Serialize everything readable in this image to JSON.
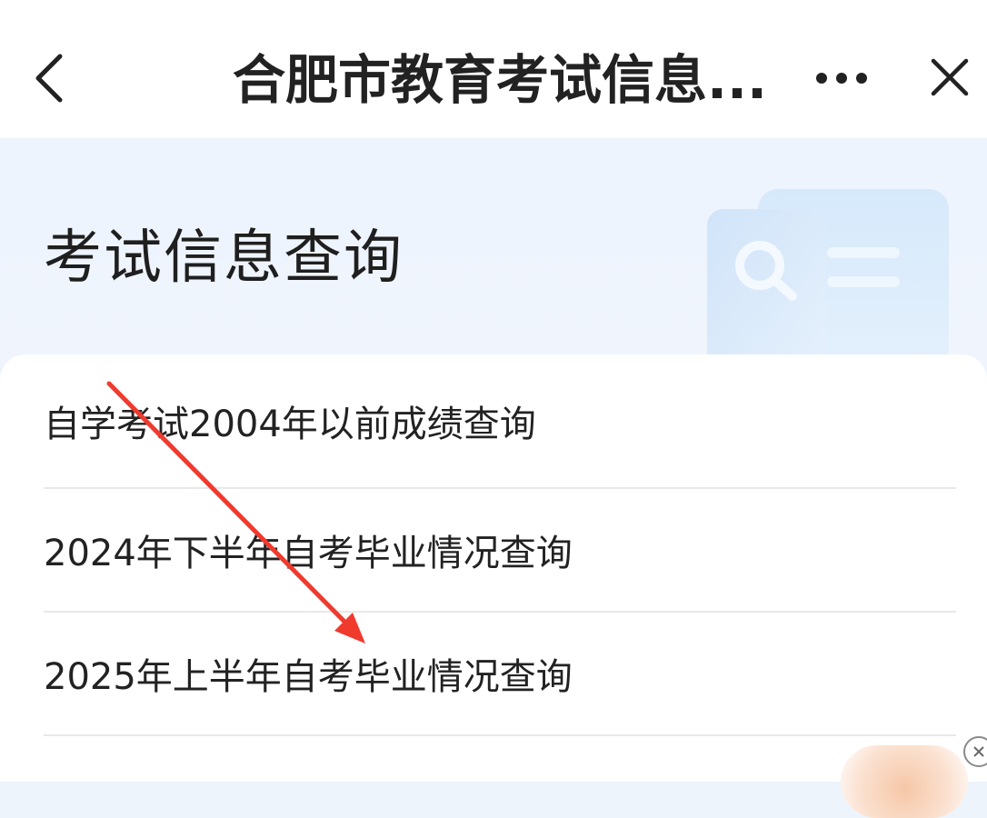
{
  "navbar": {
    "title": "合肥市教育考试信息...",
    "back_icon": "chevron-left-icon",
    "more_icon": "more-horizontal-icon",
    "close_icon": "close-icon"
  },
  "hero": {
    "title": "考试信息查询",
    "illustration_icon": "document-search-icon"
  },
  "list": {
    "items": [
      {
        "label": "自学考试2004年以前成绩查询"
      },
      {
        "label": "2024年下半年自考毕业情况查询"
      },
      {
        "label": "2025年上半年自考毕业情况查询"
      }
    ]
  },
  "colors": {
    "hero_background": "#eef4fc",
    "annotation_arrow": "#f03a2e",
    "divider": "#e8e8e8",
    "text": "#222222"
  }
}
